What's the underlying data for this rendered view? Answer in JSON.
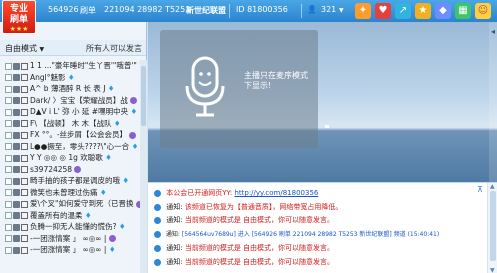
{
  "badge": {
    "line1": "专业",
    "line2": "刷单"
  },
  "topbar": {
    "room_number": "564926",
    "room_label": "刷单",
    "room_extra": "221094 28982 T5253",
    "group_name": "新世纪联盟",
    "id_text": "ID 81800356",
    "online_count": "321"
  },
  "left": {
    "mode": "自由模式",
    "mode_hint": "所有人可以发言",
    "users": [
      "1 1 ...\"豪年睡时\"生丫晋'\"哦曾'\" ? I",
      "Angl°魅影",
      "A^ b 薄酒醉 R 长 表 J",
      "Dark/ 〉宝宝【荣耀战员】战",
      "D▲V i L' 弥 小 延 #嘿明中央",
      "F\\ 【战顿】 木 木【战队",
      "FX °°。-丝步屑【公会会员】",
      "L●●撅至，零头????\\\"心一合",
      "Y Y ◎◎ ◎ 1g 欢聪歌",
      "s39724258",
      "畸手抽的孩子都是调皮的哦",
      "微笑也未曾理过伤痛",
      "爱\\个叉\"如何爱守到死（已晋换",
      "覆盖所有的温柔",
      "负腾一抑无人能懂的慌伤?",
      "-一团涨情案 」 ∞◎∞ |",
      "-一团涨情案 」 ∞◎∞ |"
    ]
  },
  "stage": {
    "notice_line1": "主播只在麦序模式",
    "notice_line2": "下显示!"
  },
  "chat": {
    "messages": [
      {
        "prefix": "本公会已开通网页YY:",
        "link": "http://yy.com/81800356"
      },
      {
        "prefix": "通知:",
        "text": "该频道已恢复为【普通音质】，网络带宽占用降低。"
      },
      {
        "prefix": "通知:",
        "text": "当前频道的模式是 自由模式，你可以随意发言。"
      },
      {
        "prefix": "通知:",
        "text": "[564564uv7689u] 进入 [564926 刷单 221094 28982 T5253 新世纪联盟] 频道 (15:40:41)"
      },
      {
        "prefix": "通知:",
        "text": "当前频道的模式是 自由模式，你可以随意发言。"
      },
      {
        "prefix": "通知:",
        "text": "当前频道的模式是 自由模式，你可以随意发言。"
      }
    ]
  },
  "colors": {
    "accent": "#2b84cf",
    "badge_red": "#d01c12",
    "notice_red": "#d21b1b",
    "link_blue": "#1a55c8"
  }
}
